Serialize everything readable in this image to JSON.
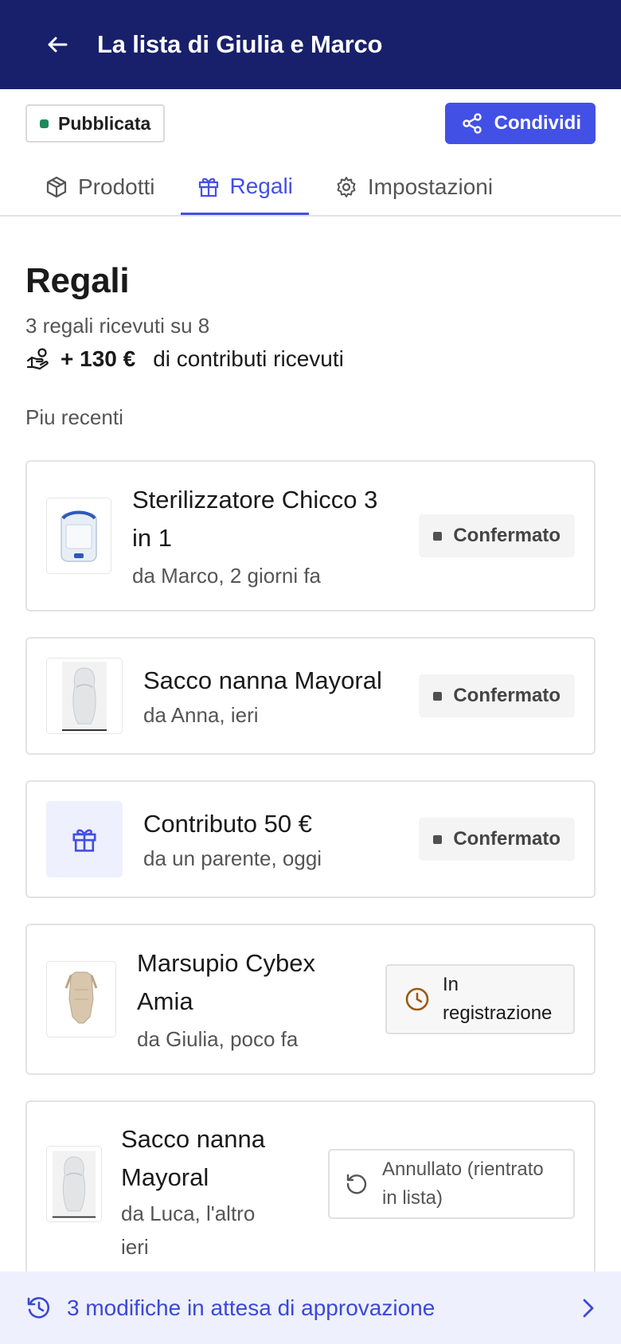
{
  "header": {
    "title": "La lista di Giulia e Marco",
    "back_icon": "arrow-left-icon"
  },
  "status_badge": {
    "label": "Pubblicata",
    "dot_color": "#1e8a5a"
  },
  "share_button": {
    "label": "Condividi"
  },
  "tabs": [
    {
      "label": "Prodotti",
      "icon": "box-icon"
    },
    {
      "label": "Regali",
      "icon": "gift-icon",
      "active": true
    },
    {
      "label": "Impostazioni",
      "icon": "gear-icon"
    }
  ],
  "section": {
    "title": "Regali",
    "summary": "3 regali ricevuti su 8",
    "contrib_amount": "+ 130 €",
    "contrib_label": "di contributi ricevuti",
    "recent_label": "Piu recenti"
  },
  "gifts": [
    {
      "title": "Sterilizzatore Chicco 3 in 1",
      "meta": "da Marco, 2 giorni fa",
      "status": "Confermato"
    },
    {
      "title": "Sacco nanna Mayoral",
      "meta": "da Anna, ieri",
      "status": "Confermato"
    },
    {
      "title": "Contributo 50 €",
      "meta": "da un parente, oggi",
      "status": "Confermato"
    },
    {
      "title": "Marsupio Cybex Amia",
      "meta": "da Giulia, poco fa",
      "status": "In registrazione"
    },
    {
      "title": "Sacco nanna Mayoral",
      "meta": "da Luca, l'altro ieri",
      "status": "Annullato (rientrato in lista)"
    }
  ],
  "footer": {
    "label": "3 modifiche in attesa di approvazione"
  },
  "colors": {
    "header_bg": "#18206b",
    "accent": "#4350e6",
    "pending_icon": "#9a5a12"
  }
}
